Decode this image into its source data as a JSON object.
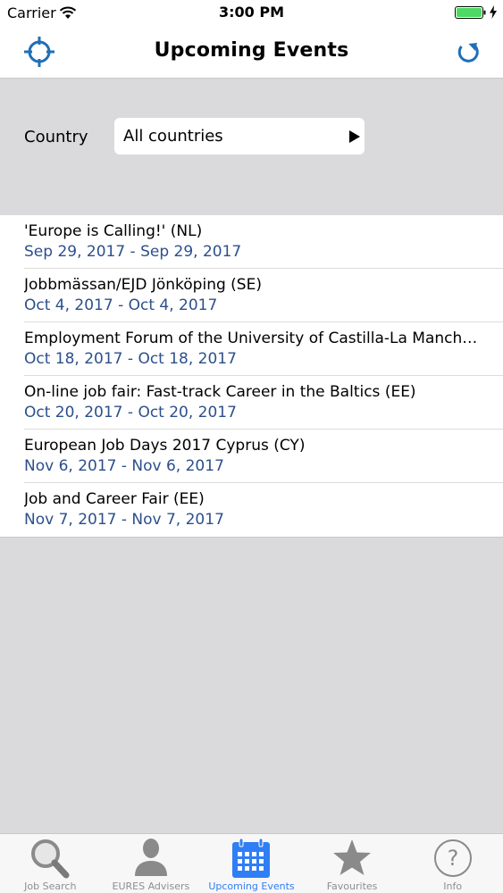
{
  "status_bar": {
    "carrier": "Carrier",
    "time": "3:00 PM",
    "battery_color": "#4cd964"
  },
  "nav": {
    "title": "Upcoming Events",
    "left_icon": "crosshair-locate-icon",
    "right_icon": "refresh-icon"
  },
  "filter": {
    "country_label": "Country",
    "country_value": "All countries"
  },
  "events": [
    {
      "title": "'Europe is Calling!' (NL)",
      "dates": "Sep 29, 2017 - Sep 29, 2017"
    },
    {
      "title": "Jobbmässan/EJD Jönköping (SE)",
      "dates": "Oct 4, 2017 - Oct 4, 2017"
    },
    {
      "title": "Employment Forum of the University of Castilla-La Manch…",
      "dates": "Oct 18, 2017 - Oct 18, 2017"
    },
    {
      "title": "On-line job fair: Fast-track Career in the Baltics (EE)",
      "dates": "Oct 20, 2017 - Oct 20, 2017"
    },
    {
      "title": "European Job Days 2017 Cyprus (CY)",
      "dates": "Nov 6, 2017 - Nov 6, 2017"
    },
    {
      "title": "Job and Career Fair (EE)",
      "dates": "Nov 7, 2017 - Nov 7, 2017"
    }
  ],
  "tabs": [
    {
      "label": "Job Search",
      "icon": "magnifier-icon",
      "active": false
    },
    {
      "label": "EURES Advisers",
      "icon": "person-icon",
      "active": false
    },
    {
      "label": "Upcoming Events",
      "icon": "calendar-icon",
      "active": true
    },
    {
      "label": "Favourites",
      "icon": "star-icon",
      "active": false
    },
    {
      "label": "Info",
      "icon": "question-icon",
      "active": false
    }
  ],
  "colors": {
    "accent": "#2f7ef5",
    "nav_icon": "#1f6fb8",
    "date_text": "#2c4f8c",
    "background": "#dadadd"
  }
}
